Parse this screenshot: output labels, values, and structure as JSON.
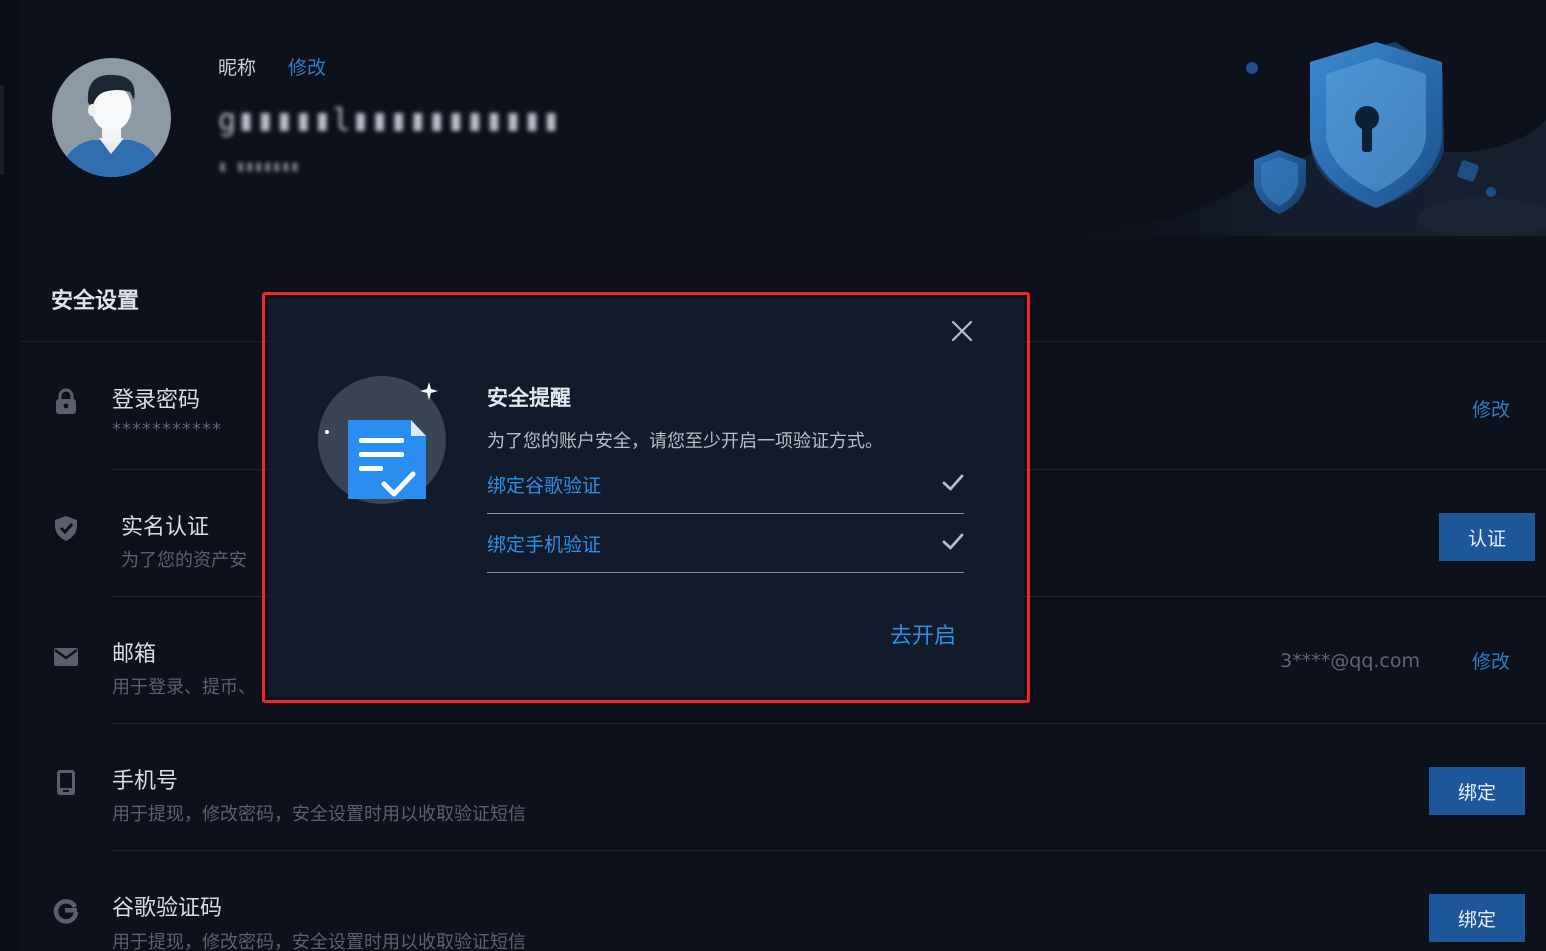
{
  "profile": {
    "nickname_label": "昵称",
    "nickname_edit": "修改",
    "blurred_name": "g▮▮▮▮▮l▮▮▮▮▮▮▮▮▮▮▮",
    "blurred_uid": "▮ ▮▮▮▮▮▮▮"
  },
  "security": {
    "section_title": "安全设置",
    "rows": [
      {
        "icon": "lock-icon",
        "title": "登录密码",
        "desc": "***********",
        "action": "修改"
      },
      {
        "icon": "shield-check-icon",
        "title": "实名认证",
        "desc": "为了您的资产安",
        "action": "认证"
      },
      {
        "icon": "mail-icon",
        "title": "邮箱",
        "desc": "用于登录、提币、",
        "value": "3****@qq.com",
        "action": "修改"
      },
      {
        "icon": "phone-icon",
        "title": "手机号",
        "desc": "用于提现，修改密码，安全设置时用以收取验证短信",
        "action": "绑定"
      },
      {
        "icon": "google-icon",
        "title": "谷歌验证码",
        "desc": "用于提现，修改密码，安全设置时用以收取验证短信",
        "action": "绑定"
      }
    ]
  },
  "modal": {
    "title": "安全提醒",
    "description": "为了您的账户安全，请您至少开启一项验证方式。",
    "options": [
      {
        "label": "绑定谷歌验证",
        "icon": "check-icon"
      },
      {
        "label": "绑定手机验证",
        "icon": "check-icon"
      }
    ],
    "confirm_label": "去开启",
    "close_icon": "close-icon"
  },
  "colors": {
    "background": "#0c111b",
    "accent_link": "#2f7dc4",
    "button": "#1e5799",
    "modal_bg": "#111b2b",
    "highlight": "#ef2727"
  }
}
